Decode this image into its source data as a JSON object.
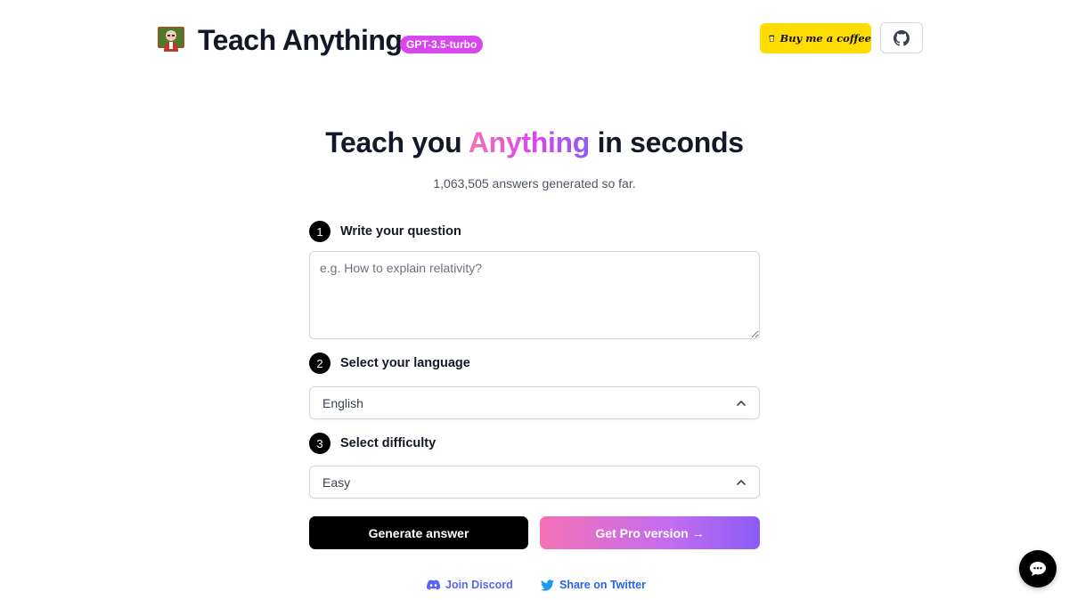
{
  "header": {
    "app_title": "Teach Anything",
    "model_badge": "GPT-3.5-turbo",
    "coffee_label": "Buy me a coffee",
    "github_icon": "github-icon",
    "logo_icon": "teacher-avatar-icon"
  },
  "hero": {
    "title_before": "Teach you",
    "title_accent": "Anything",
    "title_after": "in seconds",
    "stats": "1,063,505 answers generated so far."
  },
  "form": {
    "steps": [
      {
        "number": "1",
        "label": "Write your question"
      },
      {
        "number": "2",
        "label": "Select your language"
      },
      {
        "number": "3",
        "label": "Select difficulty"
      }
    ],
    "question": {
      "placeholder": "e.g. How to explain relativity?",
      "value": ""
    },
    "language": {
      "value": "English",
      "icon": "chevron-up-icon"
    },
    "difficulty": {
      "value": "Easy",
      "icon": "chevron-up-icon"
    },
    "generate_label": "Generate answer",
    "pro_label": "Get Pro version →"
  },
  "footer": {
    "discord_label": "Join Discord",
    "twitter_label": "Share on Twitter"
  },
  "colors": {
    "badge": "#d946ef",
    "coffee": "#ffdd00",
    "accent_from": "#f472b6",
    "accent_to": "#8b5cf6",
    "discord": "#5865f2",
    "twitter": "#1d9bf0"
  },
  "chat_widget_icon": "chat-bubble-icon"
}
